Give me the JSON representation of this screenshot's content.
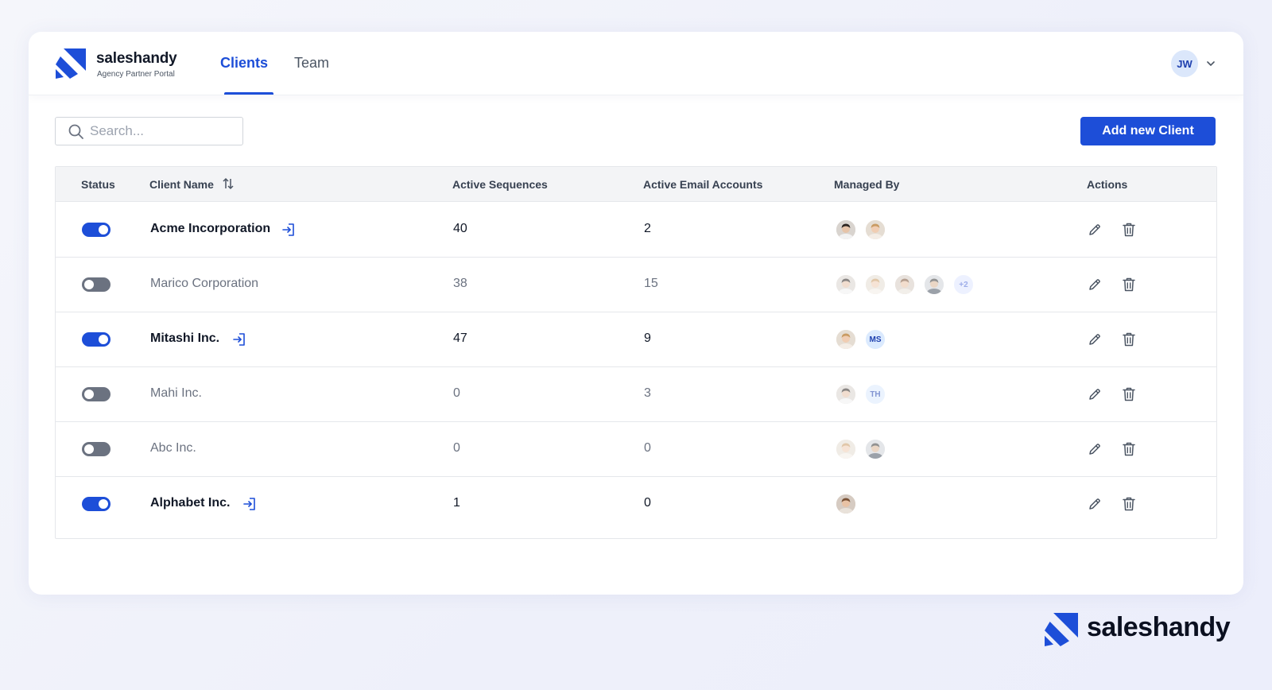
{
  "brand": {
    "name": "saleshandy",
    "subtitle": "Agency Partner Portal",
    "accent_color": "#1d4ed8"
  },
  "nav": {
    "tabs": [
      {
        "label": "Clients",
        "active": true
      },
      {
        "label": "Team",
        "active": false
      }
    ]
  },
  "user": {
    "initials": "JW",
    "menu_icon": "chevron-down-icon"
  },
  "toolbar": {
    "search_placeholder": "Search...",
    "search_value": "",
    "add_button_label": "Add new Client"
  },
  "table": {
    "headers": {
      "status": "Status",
      "client_name": "Client Name",
      "active_sequences": "Active Sequences",
      "active_email_accounts": "Active Email Accounts",
      "managed_by": "Managed By",
      "actions": "Actions"
    },
    "rows": [
      {
        "status": true,
        "name": "Acme Incorporation",
        "sequences": "40",
        "accounts": "2",
        "managers": [
          {
            "type": "photo",
            "tone": "dark-hair"
          },
          {
            "type": "photo",
            "tone": "blonde-hair"
          }
        ]
      },
      {
        "status": false,
        "name": "Marico Corporation",
        "sequences": "38",
        "accounts": "15",
        "managers": [
          {
            "type": "photo",
            "tone": "dark-hair"
          },
          {
            "type": "photo",
            "tone": "blonde-hair"
          },
          {
            "type": "photo",
            "tone": "brown-hair"
          },
          {
            "type": "photo",
            "tone": "grey-suit"
          },
          {
            "type": "more",
            "text": "+2"
          }
        ]
      },
      {
        "status": true,
        "name": "Mitashi Inc.",
        "sequences": "47",
        "accounts": "9",
        "managers": [
          {
            "type": "photo",
            "tone": "blonde-hair"
          },
          {
            "type": "initials",
            "text": "MS"
          }
        ]
      },
      {
        "status": false,
        "name": "Mahi Inc.",
        "sequences": "0",
        "accounts": "3",
        "managers": [
          {
            "type": "photo",
            "tone": "dark-hair"
          },
          {
            "type": "initials",
            "text": "TH"
          }
        ]
      },
      {
        "status": false,
        "name": "Abc Inc.",
        "sequences": "0",
        "accounts": "0",
        "managers": [
          {
            "type": "photo",
            "tone": "blonde-hair"
          },
          {
            "type": "photo",
            "tone": "grey-suit"
          }
        ]
      },
      {
        "status": true,
        "name": "Alphabet Inc.",
        "sequences": "1",
        "accounts": "0",
        "managers": [
          {
            "type": "photo",
            "tone": "brown-hair"
          }
        ]
      }
    ]
  },
  "icons": {
    "search": "search-icon",
    "sort": "sort-icon",
    "login": "login-icon",
    "edit": "pencil-icon",
    "delete": "trash-icon"
  },
  "footer": {
    "brand_name": "saleshandy"
  }
}
